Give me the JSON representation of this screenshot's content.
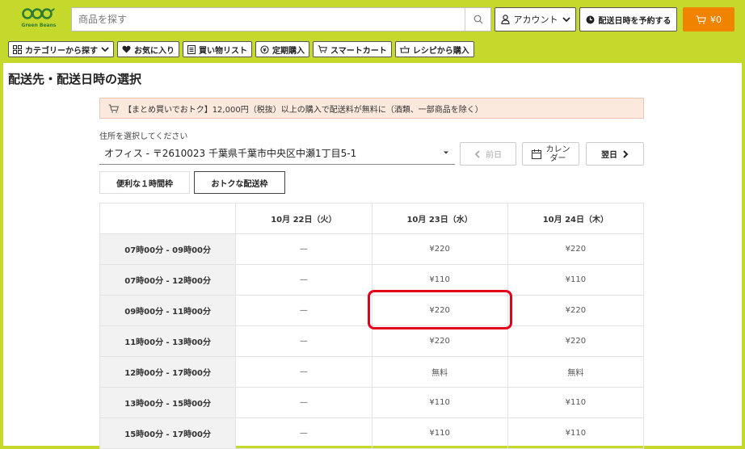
{
  "header": {
    "logo_text": "Green Beans",
    "search": {
      "placeholder": "商品を探す",
      "value": ""
    },
    "account_label": "アカウント",
    "delivery_label": "配送日時を予約する",
    "cart_label": "¥0",
    "icons": [
      "search-icon",
      "user-icon",
      "chevron-down-icon",
      "clock-icon",
      "cart-icon"
    ]
  },
  "nav": [
    {
      "label": "カテゴリーから探す",
      "icon": "grid-icon"
    },
    {
      "label": "お気に入り",
      "icon": "heart-icon"
    },
    {
      "label": "買い物リスト",
      "icon": "list-icon"
    },
    {
      "label": "定期購入",
      "icon": "repeat-icon"
    },
    {
      "label": "スマートカート",
      "icon": "cart-icon"
    },
    {
      "label": "レシピから購入",
      "icon": "pot-icon"
    }
  ],
  "page_title": "配送先・配送日時の選択",
  "promo": "【まとめ買いでおトク】12,000円（税抜）以上の購入で配送料が無料に（酒類、一部商品を除く）",
  "address": {
    "label": "住所を選択してください",
    "selected": "オフィス - 〒2610023 千葉県千葉市中央区中瀬1丁目5-1"
  },
  "day_nav": {
    "prev": "前日",
    "calendar_line1": "カレン",
    "calendar_line2": "ダー",
    "next": "翌日"
  },
  "tabs": [
    {
      "label": "便利な１時間枠",
      "active": false
    },
    {
      "label": "おトクな配送枠",
      "active": true
    }
  ],
  "table": {
    "dates": [
      "10月 22日（火）",
      "10月 23日（水）",
      "10月 24日（木）"
    ],
    "rows": [
      {
        "time": "07時00分 - 09時00分",
        "cells": [
          "—",
          "¥220",
          "¥220"
        ]
      },
      {
        "time": "07時00分 - 12時00分",
        "cells": [
          "—",
          "¥110",
          "¥110"
        ]
      },
      {
        "time": "09時00分 - 11時00分",
        "cells": [
          "—",
          "¥220",
          "¥220"
        ]
      },
      {
        "time": "11時00分 - 13時00分",
        "cells": [
          "—",
          "¥220",
          "¥220"
        ]
      },
      {
        "time": "12時00分 - 17時00分",
        "cells": [
          "—",
          "無料",
          "無料"
        ]
      },
      {
        "time": "13時00分 - 15時00分",
        "cells": [
          "—",
          "¥110",
          "¥110"
        ]
      },
      {
        "time": "15時00分 - 17時00分",
        "cells": [
          "—",
          "¥110",
          "¥110"
        ]
      }
    ]
  },
  "colors": {
    "brand": "#c5d92d",
    "cart": "#f08300",
    "promo_bg": "#fce9dd",
    "highlight": "#e3001b"
  }
}
